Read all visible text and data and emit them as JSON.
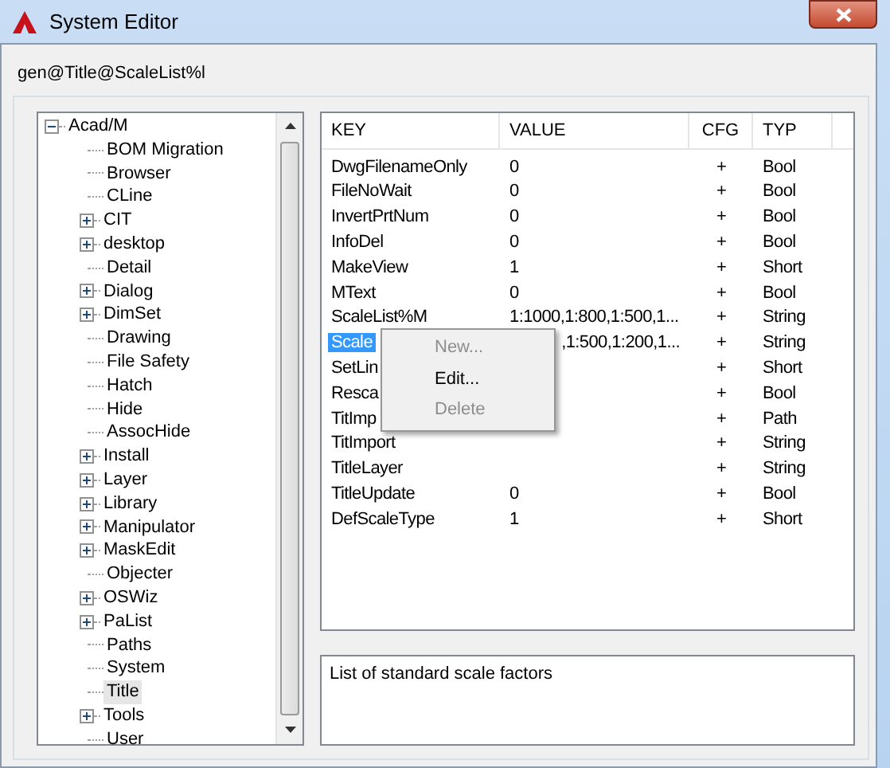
{
  "window": {
    "title": "System Editor"
  },
  "path": "gen@Title@ScaleList%l",
  "tree": [
    {
      "label": "Acad/M",
      "expanded": true,
      "selected": false,
      "children": [
        {
          "label": "BOM Migration",
          "selected": false
        },
        {
          "label": "Browser",
          "selected": false
        },
        {
          "label": "CLine",
          "selected": false
        },
        {
          "label": "CIT",
          "expanded": false,
          "selected": false
        },
        {
          "label": "desktop",
          "expanded": false,
          "selected": false
        },
        {
          "label": "Detail",
          "selected": false
        },
        {
          "label": "Dialog",
          "expanded": false,
          "selected": false
        },
        {
          "label": "DimSet",
          "expanded": false,
          "selected": false
        },
        {
          "label": "Drawing",
          "selected": false
        },
        {
          "label": "File Safety",
          "selected": false
        },
        {
          "label": "Hatch",
          "selected": false
        },
        {
          "label": "Hide",
          "selected": false
        },
        {
          "label": "AssocHide",
          "selected": false
        },
        {
          "label": "Install",
          "expanded": false,
          "selected": false
        },
        {
          "label": "Layer",
          "expanded": false,
          "selected": false
        },
        {
          "label": "Library",
          "expanded": false,
          "selected": false
        },
        {
          "label": "Manipulator",
          "expanded": false,
          "selected": false
        },
        {
          "label": "MaskEdit",
          "expanded": false,
          "selected": false
        },
        {
          "label": "Objecter",
          "selected": false
        },
        {
          "label": "OSWiz",
          "expanded": false,
          "selected": false
        },
        {
          "label": "PaList",
          "expanded": false,
          "selected": false
        },
        {
          "label": "Paths",
          "selected": false
        },
        {
          "label": "System",
          "selected": false
        },
        {
          "label": "Title",
          "selected": true
        },
        {
          "label": "Tools",
          "expanded": false,
          "selected": false
        },
        {
          "label": "User",
          "selected": false
        }
      ]
    }
  ],
  "table": {
    "columns": [
      "KEY",
      "VALUE",
      "CFG",
      "TYP"
    ],
    "rows": [
      {
        "key": "DwgFilenameOnly",
        "value": "0",
        "cfg": "+",
        "typ": "Bool",
        "selected": false
      },
      {
        "key": "FileNoWait",
        "value": "0",
        "cfg": "+",
        "typ": "Bool",
        "selected": false
      },
      {
        "key": "InvertPrtNum",
        "value": "0",
        "cfg": "+",
        "typ": "Bool",
        "selected": false
      },
      {
        "key": "InfoDel",
        "value": "0",
        "cfg": "+",
        "typ": "Bool",
        "selected": false
      },
      {
        "key": "MakeView",
        "value": "1",
        "cfg": "+",
        "typ": "Short",
        "selected": false
      },
      {
        "key": "MText",
        "value": "0",
        "cfg": "+",
        "typ": "Bool",
        "selected": false
      },
      {
        "key": "ScaleList%M",
        "value": "1:1000,1:800,1:500,1...",
        "cfg": "+",
        "typ": "String",
        "selected": false
      },
      {
        "key": "Scale",
        "value": ",1:500,1:200,1...",
        "cfg": "+",
        "typ": "String",
        "selected": true,
        "covered": true
      },
      {
        "key": "SetLin",
        "cfg": "+",
        "typ": "Short",
        "selected": false
      },
      {
        "key": "Resca",
        "cfg": "+",
        "typ": "Bool",
        "selected": false
      },
      {
        "key": "TitImp",
        "cfg": "+",
        "typ": "Path",
        "selected": false
      },
      {
        "key": "TitImport",
        "cfg": "+",
        "typ": "String",
        "selected": false
      },
      {
        "key": "TitleLayer",
        "cfg": "+",
        "typ": "String",
        "selected": false
      },
      {
        "key": "TitleUpdate",
        "value": "0",
        "cfg": "+",
        "typ": "Bool",
        "selected": false
      },
      {
        "key": "DefScaleType",
        "value": "1",
        "cfg": "+",
        "typ": "Short",
        "selected": false
      }
    ]
  },
  "context_menu": [
    {
      "label": "New...",
      "disabled": true
    },
    {
      "label": "Edit...",
      "disabled": false
    },
    {
      "label": "Delete",
      "disabled": true
    }
  ],
  "description": "List of standard scale factors"
}
